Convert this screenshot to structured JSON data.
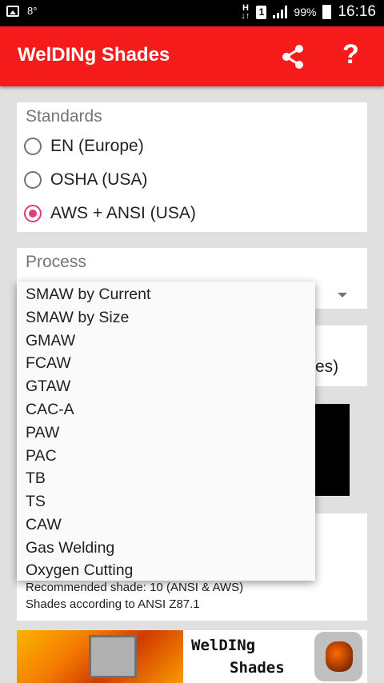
{
  "status_bar": {
    "left_text": "8°",
    "network_type": "H",
    "sim_label": "1",
    "battery": "99%",
    "time": "16:16"
  },
  "app_bar": {
    "title": "WelDINg Shades",
    "share_icon": "share-icon",
    "help_icon": "help-icon",
    "help_label": "?"
  },
  "standards": {
    "label": "Standards",
    "options": [
      {
        "label": "EN (Europe)",
        "checked": false
      },
      {
        "label": "OSHA (USA)",
        "checked": false
      },
      {
        "label": "AWS + ANSI (USA)",
        "checked": true
      }
    ]
  },
  "process": {
    "label": "Process",
    "dropdown_items": [
      "SMAW by Current",
      "SMAW by Size",
      "GMAW",
      "FCAW",
      "GTAW",
      "CAC-A",
      "PAW",
      "PAC",
      "TB",
      "TS",
      "CAW",
      "Gas Welding",
      "Oxygen Cutting"
    ]
  },
  "thickness": {
    "visible_text": "res)"
  },
  "result": {
    "line1": "Recommended shade: 10 (ANSI & AWS)",
    "line2": "Shades according to ANSI Z87.1"
  },
  "banner": {
    "title_line1": "WelDINg",
    "title_line2": "Shades"
  },
  "colors": {
    "app_bar": "#f51b1b",
    "radio_accent": "#e03c7a",
    "background": "#e0e0e0"
  }
}
